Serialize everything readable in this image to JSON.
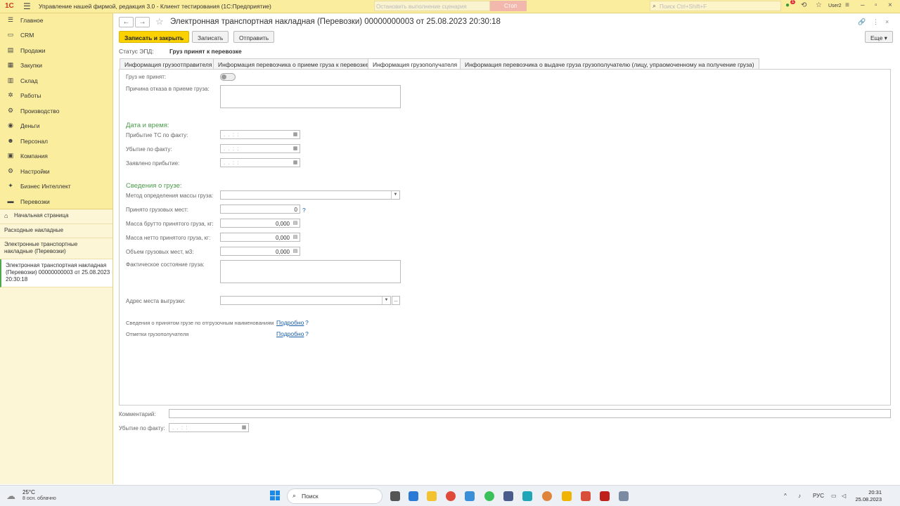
{
  "titlebar": {
    "logo": "1С",
    "app_title": "Управление нашей фирмой, редакция 3.0  - Клиент тестирования (1С:Предприятие)",
    "scenario_placeholder": "Остановить выполнение сценария",
    "stop_label": "Стоп",
    "search_placeholder": "Поиск Ctrl+Shift+F",
    "notifications_count": "1",
    "user": "User2"
  },
  "sidebar": {
    "items": [
      {
        "label": "Главное",
        "icon": "menu-icon"
      },
      {
        "label": "CRM",
        "icon": "crm-icon"
      },
      {
        "label": "Продажи",
        "icon": "sales-icon"
      },
      {
        "label": "Закупки",
        "icon": "purchases-icon"
      },
      {
        "label": "Склад",
        "icon": "warehouse-icon"
      },
      {
        "label": "Работы",
        "icon": "works-icon"
      },
      {
        "label": "Производство",
        "icon": "production-icon"
      },
      {
        "label": "Деньги",
        "icon": "money-icon"
      },
      {
        "label": "Персонал",
        "icon": "staff-icon"
      },
      {
        "label": "Компания",
        "icon": "company-icon"
      },
      {
        "label": "Настройки",
        "icon": "settings-icon"
      },
      {
        "label": "Бизнес Интеллект",
        "icon": "bi-icon"
      },
      {
        "label": "Перевозки",
        "icon": "transport-icon"
      }
    ],
    "opened": [
      {
        "label": "Начальная страница"
      },
      {
        "label": "Расходные накладные"
      },
      {
        "label": "Электронные транспортные накладные (Перевозки)"
      },
      {
        "label": "Электронная транспортная накладная (Перевозки) 00000000003 от 25.08.2023 20:30:18"
      }
    ]
  },
  "document": {
    "title": "Электронная транспортная накладная (Перевозки) 00000000003 от 25.08.2023 20:30:18",
    "buttons": {
      "save_close": "Записать и закрыть",
      "save": "Записать",
      "send": "Отправить",
      "more": "Еще"
    },
    "status_label": "Статус ЭПД:",
    "status_value": "Груз принят к перевозке",
    "tabs": [
      "Информация грузоотправителя",
      "Информация перевозчика о приеме груза к перевозке",
      "Информация грузополучателя",
      "Информация перевозчика о выдаче груза грузополучателю (лицу, упраомоченному на получение груза)"
    ],
    "active_tab": 2
  },
  "form": {
    "not_accepted_label": "Груз не принят:",
    "reject_reason_label": "Причина отказа в приеме груза:",
    "section_datetime": "Дата и время:",
    "arrival_fact_label": "Прибытие ТС по факту:",
    "departure_fact_label": "Убытие по факту:",
    "declared_arrival_label": "Заявлено прибытие:",
    "date_mask": ". .   : :",
    "section_cargo": "Сведения о грузе:",
    "mass_method_label": "Метод определения массы груза:",
    "places_label": "Принято грузовых мест:",
    "places_value": "0",
    "gross_label": "Масса брутто принятого груза, кг:",
    "gross_value": "0,000",
    "net_label": "Масса нетто принятого груза, кг:",
    "net_value": "0,000",
    "volume_label": "Объем грузовых мест, м3:",
    "volume_value": "0,000",
    "actual_state_label": "Фактическое состояние груза:",
    "unload_address_label": "Адрес места выгрузки:",
    "accepted_info_label": "Сведения о принятом грузе по отгрузочным наименованиям",
    "consignee_marks_label": "Отметки грузополучателя",
    "details_link": "Подробно",
    "help": "?"
  },
  "footer": {
    "comment_label": "Комментарий:",
    "departure_label": "Убытие по факту:"
  },
  "taskbar": {
    "temperature": "25°C",
    "weather": "8 осн. облачно",
    "search": "Поиск",
    "lang": "РУС",
    "time": "20:31",
    "date": "25.08.2023"
  }
}
